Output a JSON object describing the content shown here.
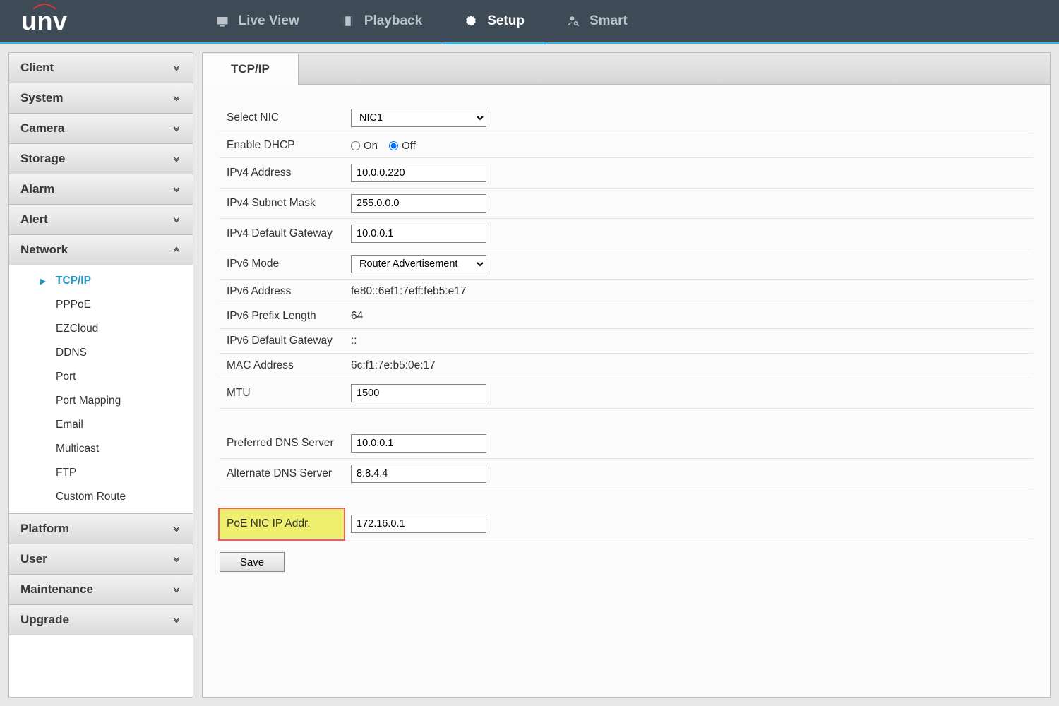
{
  "header": {
    "logo_text": "unv",
    "nav": [
      {
        "label": "Live View",
        "icon": "monitor"
      },
      {
        "label": "Playback",
        "icon": "film"
      },
      {
        "label": "Setup",
        "icon": "gear",
        "active": true
      },
      {
        "label": "Smart",
        "icon": "person-search"
      }
    ]
  },
  "sidebar": {
    "panels": [
      {
        "label": "Client",
        "expanded": false
      },
      {
        "label": "System",
        "expanded": false
      },
      {
        "label": "Camera",
        "expanded": false
      },
      {
        "label": "Storage",
        "expanded": false
      },
      {
        "label": "Alarm",
        "expanded": false
      },
      {
        "label": "Alert",
        "expanded": false
      },
      {
        "label": "Network",
        "expanded": true,
        "items": [
          {
            "label": "TCP/IP",
            "active": true
          },
          {
            "label": "PPPoE"
          },
          {
            "label": "EZCloud"
          },
          {
            "label": "DDNS"
          },
          {
            "label": "Port"
          },
          {
            "label": "Port Mapping"
          },
          {
            "label": "Email"
          },
          {
            "label": "Multicast"
          },
          {
            "label": "FTP"
          },
          {
            "label": "Custom Route"
          }
        ]
      },
      {
        "label": "Platform",
        "expanded": false
      },
      {
        "label": "User",
        "expanded": false
      },
      {
        "label": "Maintenance",
        "expanded": false
      },
      {
        "label": "Upgrade",
        "expanded": false
      }
    ]
  },
  "tabs": {
    "active": "TCP/IP"
  },
  "form": {
    "select_nic_label": "Select NIC",
    "select_nic_value": "NIC1",
    "enable_dhcp_label": "Enable DHCP",
    "dhcp_on": "On",
    "dhcp_off": "Off",
    "dhcp_value": "Off",
    "ipv4_addr_label": "IPv4 Address",
    "ipv4_addr_value": "10.0.0.220",
    "ipv4_mask_label": "IPv4 Subnet Mask",
    "ipv4_mask_value": "255.0.0.0",
    "ipv4_gw_label": "IPv4 Default Gateway",
    "ipv4_gw_value": "10.0.0.1",
    "ipv6_mode_label": "IPv6 Mode",
    "ipv6_mode_value": "Router Advertisement",
    "ipv6_addr_label": "IPv6 Address",
    "ipv6_addr_value": "fe80::6ef1:7eff:feb5:e17",
    "ipv6_prefix_label": "IPv6 Prefix Length",
    "ipv6_prefix_value": "64",
    "ipv6_gw_label": "IPv6 Default Gateway",
    "ipv6_gw_value": "::",
    "mac_label": "MAC Address",
    "mac_value": "6c:f1:7e:b5:0e:17",
    "mtu_label": "MTU",
    "mtu_value": "1500",
    "pref_dns_label": "Preferred DNS Server",
    "pref_dns_value": "10.0.0.1",
    "alt_dns_label": "Alternate DNS Server",
    "alt_dns_value": "8.8.4.4",
    "poe_label": "PoE NIC IP Addr.",
    "poe_value": "172.16.0.1",
    "save_label": "Save"
  }
}
